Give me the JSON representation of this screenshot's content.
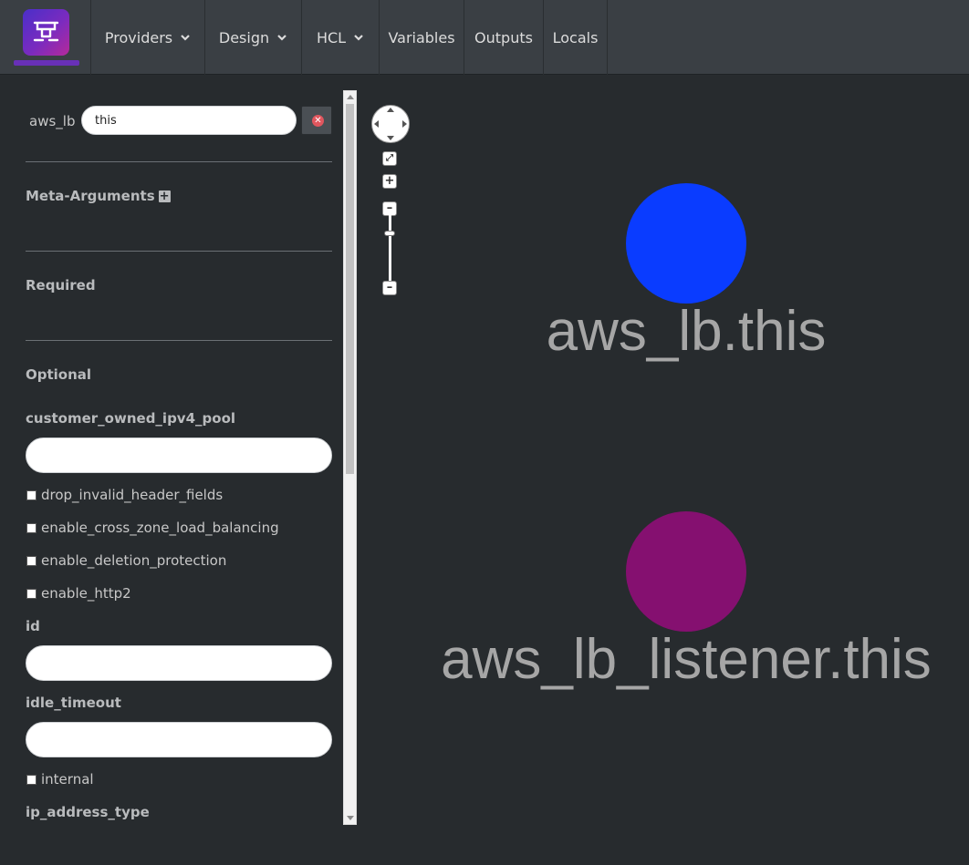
{
  "nav": {
    "items": [
      {
        "label": "Providers",
        "dropdown": true
      },
      {
        "label": "Design",
        "dropdown": true
      },
      {
        "label": "HCL",
        "dropdown": true
      },
      {
        "label": "Variables",
        "dropdown": false
      },
      {
        "label": "Outputs",
        "dropdown": false
      },
      {
        "label": "Locals",
        "dropdown": false
      }
    ]
  },
  "editor": {
    "resource_type": "aws_lb",
    "resource_name": "this",
    "sections": {
      "meta": "Meta-Arguments",
      "required": "Required",
      "optional": "Optional"
    },
    "fields": {
      "customer_owned_ipv4_pool": {
        "label": "customer_owned_ipv4_pool",
        "value": ""
      },
      "drop_invalid_header_fields": {
        "label": "drop_invalid_header_fields",
        "checked": false
      },
      "enable_cross_zone_load_balancing": {
        "label": "enable_cross_zone_load_balancing",
        "checked": false
      },
      "enable_deletion_protection": {
        "label": "enable_deletion_protection",
        "checked": false
      },
      "enable_http2": {
        "label": "enable_http2",
        "checked": false
      },
      "id": {
        "label": "id",
        "value": ""
      },
      "idle_timeout": {
        "label": "idle_timeout",
        "value": ""
      },
      "internal": {
        "label": "internal",
        "checked": false
      },
      "ip_address_type": {
        "label": "ip_address_type"
      }
    }
  },
  "graph": {
    "nodes": [
      {
        "label": "aws_lb.this",
        "color": "#0a3cff"
      },
      {
        "label": "aws_lb_listener.this",
        "color": "#851070"
      }
    ],
    "label_color": "#a6a6a6",
    "background": "#272b2e"
  }
}
